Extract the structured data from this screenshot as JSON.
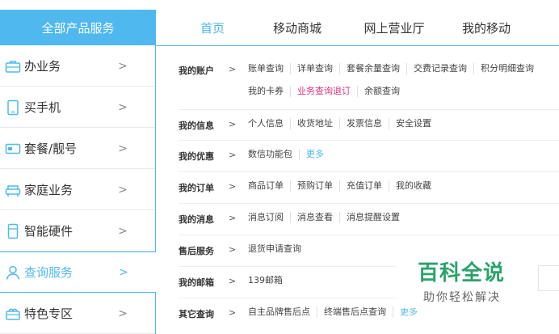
{
  "sidebar": {
    "header": "全部产品服务",
    "items": [
      {
        "label": "办业务",
        "icon": "briefcase-icon",
        "arrow": ">"
      },
      {
        "label": "买手机",
        "icon": "phone-icon",
        "arrow": ">"
      },
      {
        "label": "套餐/靓号",
        "icon": "card-icon",
        "arrow": ">"
      },
      {
        "label": "家庭业务",
        "icon": "sofa-icon",
        "arrow": ">"
      },
      {
        "label": "智能硬件",
        "icon": "device-icon",
        "arrow": ">"
      },
      {
        "label": "查询服务",
        "icon": "person-icon",
        "arrow": ">"
      },
      {
        "label": "特色专区",
        "icon": "gift-icon",
        "arrow": ">"
      }
    ]
  },
  "topnav": [
    "首页",
    "移动商城",
    "网上营业厅",
    "我的移动"
  ],
  "rows": [
    {
      "title": "我的账户",
      "arrow": ">",
      "lines": [
        [
          "账单查询",
          "详单查询",
          "套餐余量查询",
          "交费记录查询",
          "积分明细查询"
        ],
        [
          "我的卡券",
          "业务查询退订",
          "余额查询"
        ]
      ]
    },
    {
      "title": "我的信息",
      "arrow": ">",
      "lines": [
        [
          "个人信息",
          "收货地址",
          "发票信息",
          "安全设置"
        ]
      ]
    },
    {
      "title": "我的优惠",
      "arrow": ">",
      "lines": [
        [
          "数信功能包",
          "更多"
        ]
      ]
    },
    {
      "title": "我的订单",
      "arrow": ">",
      "lines": [
        [
          "商品订单",
          "预购订单",
          "充值订单",
          "我的收藏"
        ]
      ]
    },
    {
      "title": "我的消息",
      "arrow": ">",
      "lines": [
        [
          "消息订阅",
          "消息查看",
          "消息提醒设置"
        ]
      ]
    },
    {
      "title": "售后服务",
      "arrow": ">",
      "lines": [
        [
          "退货申请查询"
        ]
      ]
    },
    {
      "title": "我的邮箱",
      "arrow": ">",
      "lines": [
        [
          "139邮箱"
        ]
      ]
    },
    {
      "title": "其它查询",
      "arrow": ">",
      "lines": [
        [
          "自主品牌售后点",
          "终端售后点查询",
          "更多"
        ]
      ]
    }
  ],
  "watermark": {
    "title": "百科全说",
    "subtitle": "助你轻松解决"
  },
  "colors": {
    "accent": "#4fb8ef",
    "highlight": "#e0307d",
    "watermark": "#2aa36b"
  }
}
